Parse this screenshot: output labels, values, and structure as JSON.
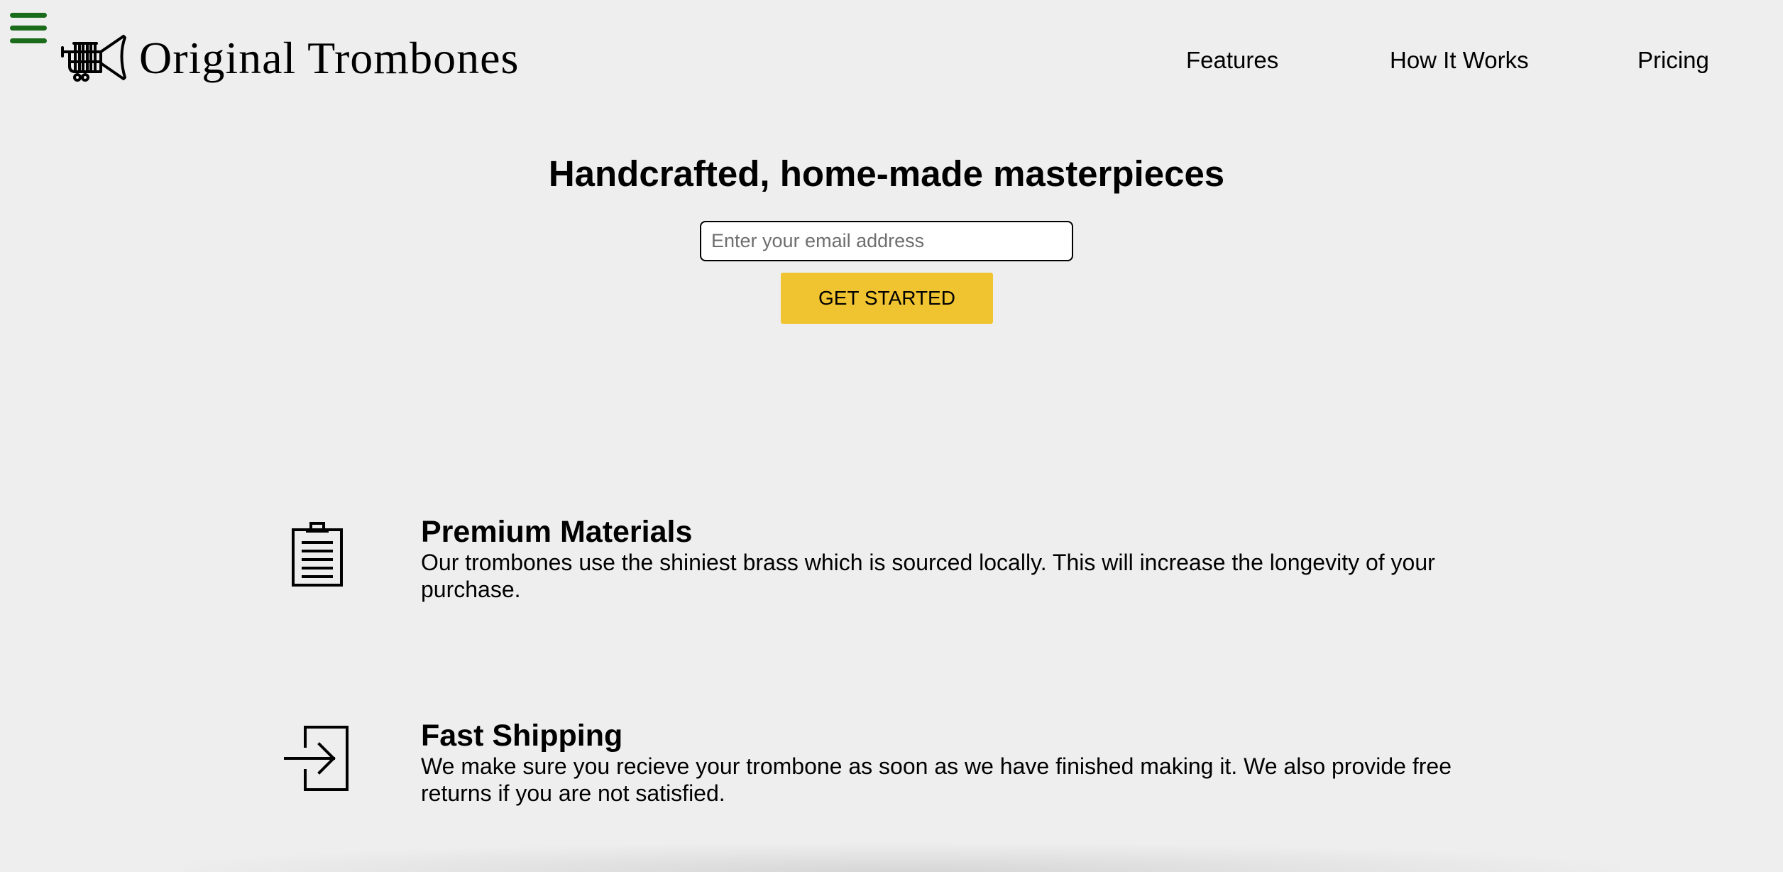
{
  "header": {
    "brand_name": "Original Trombones",
    "logo_icon": "trumpet-icon",
    "menu_icon": "hamburger-menu-icon",
    "menu_color": "#1a6b1a",
    "nav": [
      {
        "label": "Features"
      },
      {
        "label": "How It Works"
      },
      {
        "label": "Pricing"
      }
    ]
  },
  "hero": {
    "title": "Handcrafted, home-made masterpieces",
    "email_placeholder": "Enter your email address",
    "email_value": "",
    "cta_label": "GET STARTED",
    "cta_color": "#f0c330"
  },
  "features": [
    {
      "icon": "clipboard-icon",
      "title": "Premium Materials",
      "description": "Our trombones use the shiniest brass which is sourced locally. This will increase the longevity of your purchase."
    },
    {
      "icon": "sign-in-icon",
      "title": "Fast Shipping",
      "description": "We make sure you recieve your trombone as soon as we have finished making it. We also provide free returns if you are not satisfied."
    }
  ],
  "colors": {
    "background": "#eeeeee",
    "text": "#000000"
  }
}
